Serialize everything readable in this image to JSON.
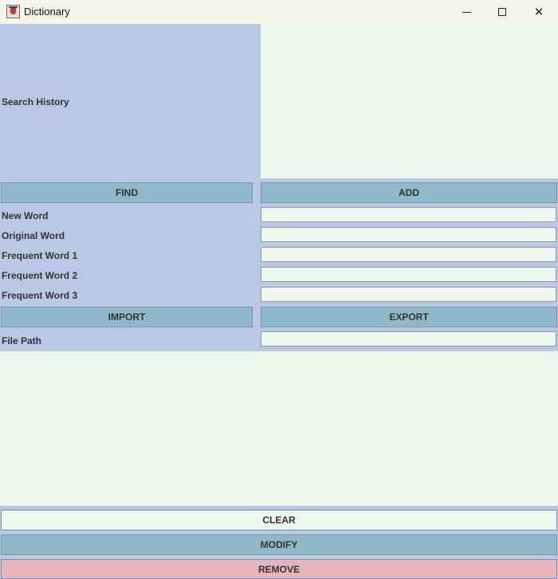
{
  "window": {
    "title": "Dictionary",
    "app_icon": "java-cup-icon"
  },
  "titlebar_controls": {
    "minimize_icon": "minimize-icon",
    "maximize_icon": "maximize-icon",
    "close_icon": "close-icon",
    "close_glyph": "✕"
  },
  "search": {
    "history_label": "Search History",
    "history_text": ""
  },
  "actions": {
    "find": "FIND",
    "add": "ADD",
    "import": "IMPORT",
    "export": "EXPORT",
    "clear": "CLEAR",
    "modify": "MODIFY",
    "remove": "REMOVE"
  },
  "fields": {
    "new_word": {
      "label": "New Word",
      "value": ""
    },
    "original_word": {
      "label": "Original Word",
      "value": ""
    },
    "frequent_word_1": {
      "label": "Frequent Word 1",
      "value": ""
    },
    "frequent_word_2": {
      "label": "Frequent Word 2",
      "value": ""
    },
    "frequent_word_3": {
      "label": "Frequent Word 3",
      "value": ""
    },
    "file_path": {
      "label": "File Path",
      "value": ""
    }
  },
  "output": {
    "text": ""
  },
  "colors": {
    "panel_background": "#b9c9e5",
    "text_area_background": "#edf7ed",
    "button_blue": "#8fb9c8",
    "button_remove": "#e8b5bd",
    "titlebar": "#f6f5ea"
  }
}
